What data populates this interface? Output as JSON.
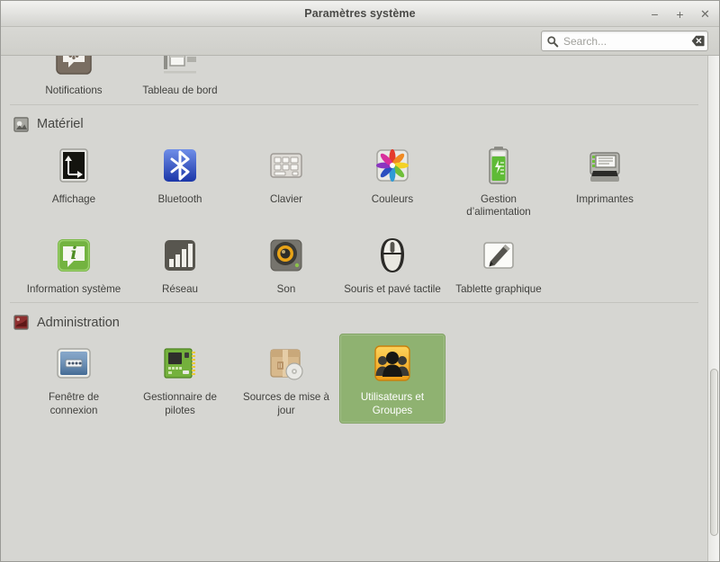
{
  "window": {
    "title": "Paramètres système",
    "controls": [
      {
        "name": "minimize",
        "glyph": "−"
      },
      {
        "name": "maximize",
        "glyph": "+"
      },
      {
        "name": "close",
        "glyph": "✕"
      }
    ]
  },
  "search": {
    "placeholder": "Search...",
    "value": "",
    "icon": "search-icon",
    "clear_icon": "clear-backspace-icon"
  },
  "colors": {
    "background": "#d6d6d2",
    "titlebar_top": "#f2f2f0",
    "titlebar_bottom": "#d2d2ce",
    "selection": "#8fb271",
    "selection_border": "#7ea05f",
    "text": "#41413e",
    "separator": "#c3c3be"
  },
  "partial_group": {
    "items": [
      {
        "label": "Notifications",
        "icon": "notifications-icon"
      },
      {
        "label": "Tableau de bord",
        "icon": "dashboard-icon"
      }
    ]
  },
  "groups": [
    {
      "title": "Matériel",
      "icon": "hardware-icon",
      "items": [
        {
          "label": "Affichage",
          "icon": "display-icon",
          "selected": false
        },
        {
          "label": "Bluetooth",
          "icon": "bluetooth-icon",
          "selected": false
        },
        {
          "label": "Clavier",
          "icon": "keyboard-icon",
          "selected": false
        },
        {
          "label": "Couleurs",
          "icon": "colors-icon",
          "selected": false
        },
        {
          "label": "Gestion d’alimentation",
          "icon": "power-battery-icon",
          "selected": false
        },
        {
          "label": "Imprimantes",
          "icon": "printer-icon",
          "selected": false
        },
        {
          "label": "Information système",
          "icon": "system-info-icon",
          "selected": false
        },
        {
          "label": "Réseau",
          "icon": "network-signal-icon",
          "selected": false
        },
        {
          "label": "Son",
          "icon": "sound-speaker-icon",
          "selected": false
        },
        {
          "label": "Souris et pavé tactile",
          "icon": "mouse-touchpad-icon",
          "selected": false
        },
        {
          "label": "Tablette graphique",
          "icon": "graphics-tablet-icon",
          "selected": false
        }
      ]
    },
    {
      "title": "Administration",
      "icon": "administration-icon",
      "items": [
        {
          "label": "Fenêtre de connexion",
          "icon": "login-window-icon",
          "selected": false
        },
        {
          "label": "Gestionnaire de pilotes",
          "icon": "driver-manager-icon",
          "selected": false
        },
        {
          "label": "Sources de mise à jour",
          "icon": "update-sources-icon",
          "selected": false
        },
        {
          "label": "Utilisateurs et Groupes",
          "icon": "users-groups-icon",
          "selected": true
        }
      ]
    }
  ]
}
